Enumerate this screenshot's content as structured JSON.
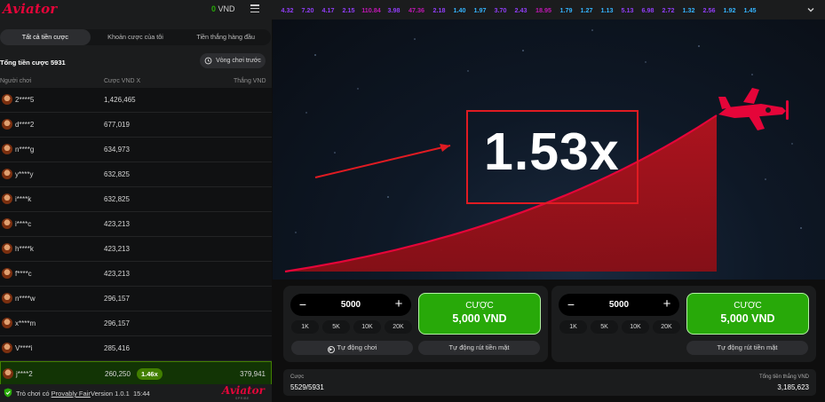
{
  "app": {
    "logo": "Aviator",
    "logo_sub": "SPRIBE"
  },
  "topbar": {
    "balance_amount": "0",
    "balance_currency": "VND",
    "history": [
      {
        "v": "4.32",
        "c": "#913ef8"
      },
      {
        "v": "7.20",
        "c": "#913ef8"
      },
      {
        "v": "4.17",
        "c": "#913ef8"
      },
      {
        "v": "2.15",
        "c": "#913ef8"
      },
      {
        "v": "110.84",
        "c": "#c017b4"
      },
      {
        "v": "3.98",
        "c": "#913ef8"
      },
      {
        "v": "47.36",
        "c": "#c017b4"
      },
      {
        "v": "2.18",
        "c": "#913ef8"
      },
      {
        "v": "1.40",
        "c": "#34b4ff"
      },
      {
        "v": "1.97",
        "c": "#34b4ff"
      },
      {
        "v": "3.70",
        "c": "#913ef8"
      },
      {
        "v": "2.43",
        "c": "#913ef8"
      },
      {
        "v": "18.95",
        "c": "#c017b4"
      },
      {
        "v": "1.79",
        "c": "#34b4ff"
      },
      {
        "v": "1.27",
        "c": "#34b4ff"
      },
      {
        "v": "1.13",
        "c": "#34b4ff"
      },
      {
        "v": "5.13",
        "c": "#913ef8"
      },
      {
        "v": "6.98",
        "c": "#913ef8"
      },
      {
        "v": "2.72",
        "c": "#913ef8"
      },
      {
        "v": "1.32",
        "c": "#34b4ff"
      },
      {
        "v": "2.56",
        "c": "#913ef8"
      },
      {
        "v": "1.92",
        "c": "#34b4ff"
      },
      {
        "v": "1.45",
        "c": "#34b4ff"
      }
    ]
  },
  "left": {
    "tabs": [
      "Tất cả tiền cược",
      "Khoản cược của tôi",
      "Tiền thắng hàng đầu"
    ],
    "total_label": "Tổng tiền cược 5931",
    "prev_round": "Vòng chơi trước",
    "columns": {
      "player": "Người chơi",
      "bet": "Cược VND X",
      "win": "Thắng VND"
    },
    "rows": [
      {
        "name": "2****5",
        "bet": "1,426,465",
        "mult": "",
        "win": ""
      },
      {
        "name": "d****2",
        "bet": "677,019",
        "mult": "",
        "win": ""
      },
      {
        "name": "n****g",
        "bet": "634,973",
        "mult": "",
        "win": ""
      },
      {
        "name": "y****y",
        "bet": "632,825",
        "mult": "",
        "win": ""
      },
      {
        "name": "i****k",
        "bet": "632,825",
        "mult": "",
        "win": ""
      },
      {
        "name": "i****c",
        "bet": "423,213",
        "mult": "",
        "win": ""
      },
      {
        "name": "h****k",
        "bet": "423,213",
        "mult": "",
        "win": ""
      },
      {
        "name": "f****c",
        "bet": "423,213",
        "mult": "",
        "win": ""
      },
      {
        "name": "n****w",
        "bet": "296,157",
        "mult": "",
        "win": ""
      },
      {
        "name": "x****m",
        "bet": "296,157",
        "mult": "",
        "win": ""
      },
      {
        "name": "V****i",
        "bet": "285,416",
        "mult": "",
        "win": ""
      },
      {
        "name": "j****2",
        "bet": "260,250",
        "mult": "1.46x",
        "win": "379,941"
      }
    ],
    "footer": {
      "provably_prefix": "Trò chơi có ",
      "provably_link": "Provably Fair",
      "version": "Version 1.0.1",
      "time": "15:44"
    }
  },
  "game": {
    "multiplier": "1.53x",
    "accent": "#e50539",
    "frame_color": "#e01b22"
  },
  "bets": [
    {
      "amount": "5000",
      "quick": [
        "1K",
        "5K",
        "10K",
        "20K"
      ],
      "btn_label": "CƯỢC",
      "btn_amount": "5,000 VND",
      "auto_play": "Tự động chơi",
      "auto_cashout": "Tự động rút tiền mặt"
    },
    {
      "amount": "5000",
      "quick": [
        "1K",
        "5K",
        "10K",
        "20K"
      ],
      "btn_label": "CƯỢC",
      "btn_amount": "5,000 VND",
      "auto_cashout": "Tự động rút tiền mặt"
    }
  ],
  "bottom": {
    "bets_label": "Cược",
    "bets_value": "5529/5931",
    "total_win_label": "Tổng tiền thắng VND",
    "total_win_value": "3,185,623"
  }
}
